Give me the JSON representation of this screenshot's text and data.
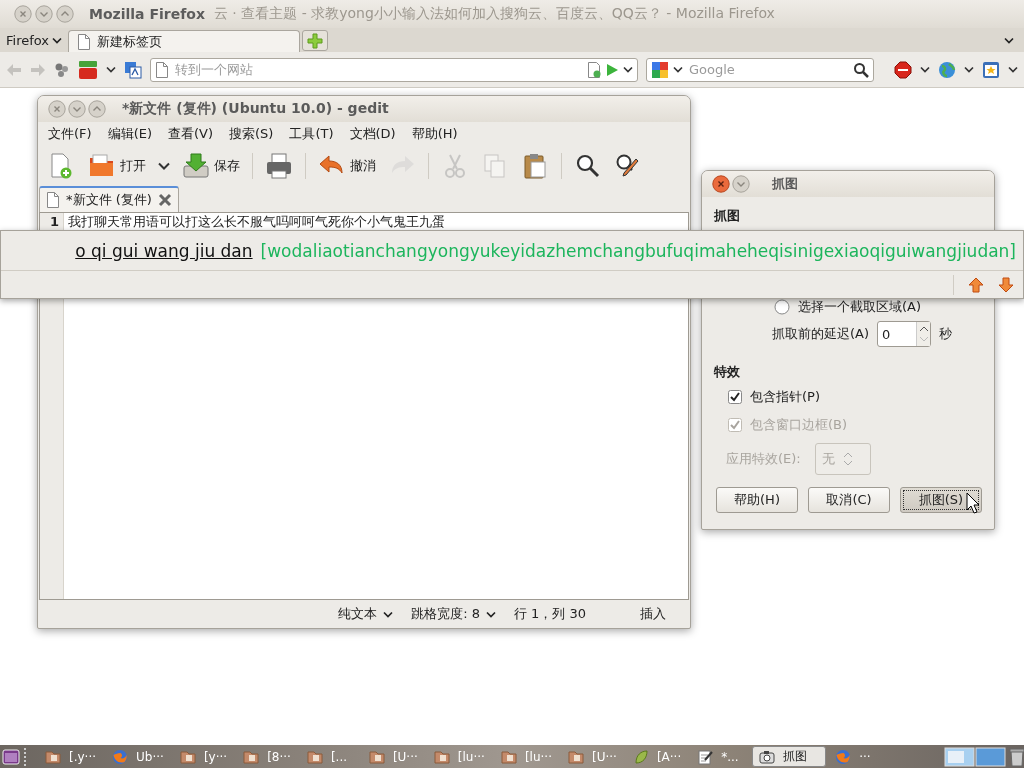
{
  "firefox": {
    "title": "Mozilla Firefox",
    "background_title": "云 · 查看主题 - 求教yong小小输入法如何加入搜狗云、百度云、QQ云？ - Mozilla Firefox",
    "menu_button": "Firefox",
    "tabs": [
      {
        "label": "新建标签页",
        "selected": true
      }
    ],
    "address_placeholder": "转到一个网站",
    "search_placeholder": "Google"
  },
  "gedit": {
    "title": "*新文件 (复件) (Ubuntu 10.0) - gedit",
    "menu": [
      "文件(F)",
      "编辑(E)",
      "查看(V)",
      "搜索(S)",
      "工具(T)",
      "文档(D)",
      "帮助(H)"
    ],
    "toolbar": [
      {
        "kind": "new",
        "disabled": false
      },
      {
        "kind": "open",
        "label": "打开",
        "disabled": false
      },
      {
        "kind": "dropdown",
        "disabled": false
      },
      {
        "kind": "save",
        "label": "保存",
        "disabled": false
      },
      {
        "kind": "separator"
      },
      {
        "kind": "print",
        "disabled": false
      },
      {
        "kind": "separator"
      },
      {
        "kind": "undo",
        "label": "撤消",
        "disabled": false
      },
      {
        "kind": "redo",
        "disabled": true
      },
      {
        "kind": "separator"
      },
      {
        "kind": "cut",
        "disabled": true
      },
      {
        "kind": "copy",
        "disabled": true
      },
      {
        "kind": "paste",
        "disabled": false
      },
      {
        "kind": "separator"
      },
      {
        "kind": "find",
        "disabled": false
      },
      {
        "kind": "replace",
        "disabled": false
      }
    ],
    "tabs": [
      {
        "label": "*新文件 (复件)",
        "selected": true
      }
    ],
    "lines": [
      {
        "number": "1",
        "text": "我打聊天常用语可以打这么长不服气吗呵呵气死你个小气鬼王九蛋"
      }
    ],
    "status": {
      "language": "纯文本",
      "tab_width": "跳格宽度: 8",
      "position": "行 1，列 30",
      "mode": "插入"
    }
  },
  "dialog": {
    "title": "抓图",
    "heading": "抓图",
    "radio": {
      "label": "选择一个截取区域(A)",
      "selected": false
    },
    "delay_label": "抓取前的延迟(A)",
    "delay_value": "0",
    "delay_unit": "秒",
    "effects_heading": "特效",
    "checkboxes": [
      {
        "label": "包含指针(P)",
        "checked": true,
        "disabled": false
      },
      {
        "label": "包含窗口边框(B)",
        "checked": true,
        "disabled": true
      }
    ],
    "effect_label": "应用特效(E):",
    "effect_value": "无",
    "effect_disabled": true,
    "buttons": [
      {
        "label": "帮助(H)",
        "focused": false
      },
      {
        "label": "取消(C)",
        "focused": false
      },
      {
        "label": "抓图(S)",
        "focused": true
      }
    ]
  },
  "ime": {
    "preedit": "o qi gui wang jiu dan",
    "candidate": "[wodaliaotianchangyongyukeyidazhemchangbufuqimaheheqisinigexiaoqiguiwangjiudan]"
  },
  "taskbar": {
    "items": [
      {
        "kind": "folder",
        "label": "[.y···",
        "selected": false
      },
      {
        "kind": "browser",
        "label": "Ub···",
        "selected": false
      },
      {
        "kind": "folder",
        "label": "[y···",
        "selected": false
      },
      {
        "kind": "folder",
        "label": "[8···",
        "selected": false
      },
      {
        "kind": "folder",
        "label": "[...",
        "selected": false
      },
      {
        "kind": "folder",
        "label": "[U···",
        "selected": false
      },
      {
        "kind": "folder",
        "label": "[lu···",
        "selected": false
      },
      {
        "kind": "folder",
        "label": "[lu···",
        "selected": false
      },
      {
        "kind": "folder",
        "label": "[U···",
        "selected": false
      },
      {
        "kind": "leaf",
        "label": "[A···",
        "selected": false
      },
      {
        "kind": "editor",
        "label": "*...",
        "selected": false
      },
      {
        "kind": "camera",
        "label": "抓图",
        "selected": true
      },
      {
        "kind": "browser",
        "label": "···",
        "selected": false
      }
    ]
  }
}
